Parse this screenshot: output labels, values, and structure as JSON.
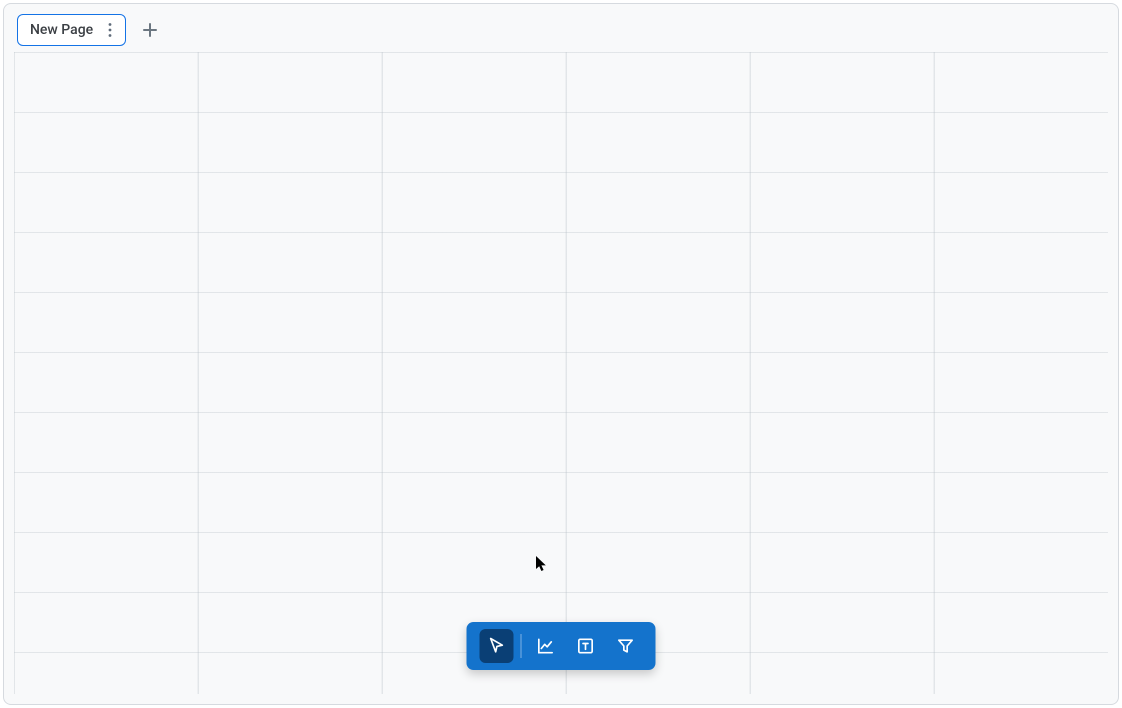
{
  "tabs": {
    "current": {
      "label": "New Page"
    },
    "add_tooltip": "Add page",
    "menu_tooltip": "Page options"
  },
  "toolbar": {
    "tools": [
      {
        "name": "pointer",
        "icon": "pointer-icon",
        "active": true
      },
      {
        "name": "chart",
        "icon": "line-chart-icon",
        "active": false
      },
      {
        "name": "text-box",
        "icon": "text-box-icon",
        "active": false
      },
      {
        "name": "filter",
        "icon": "filter-icon",
        "active": false
      }
    ]
  },
  "colors": {
    "accent": "#1473e6",
    "toolbar_bg": "#1473cc",
    "toolbar_active": "#0a3f75",
    "canvas_bg": "#f8f9fa"
  }
}
